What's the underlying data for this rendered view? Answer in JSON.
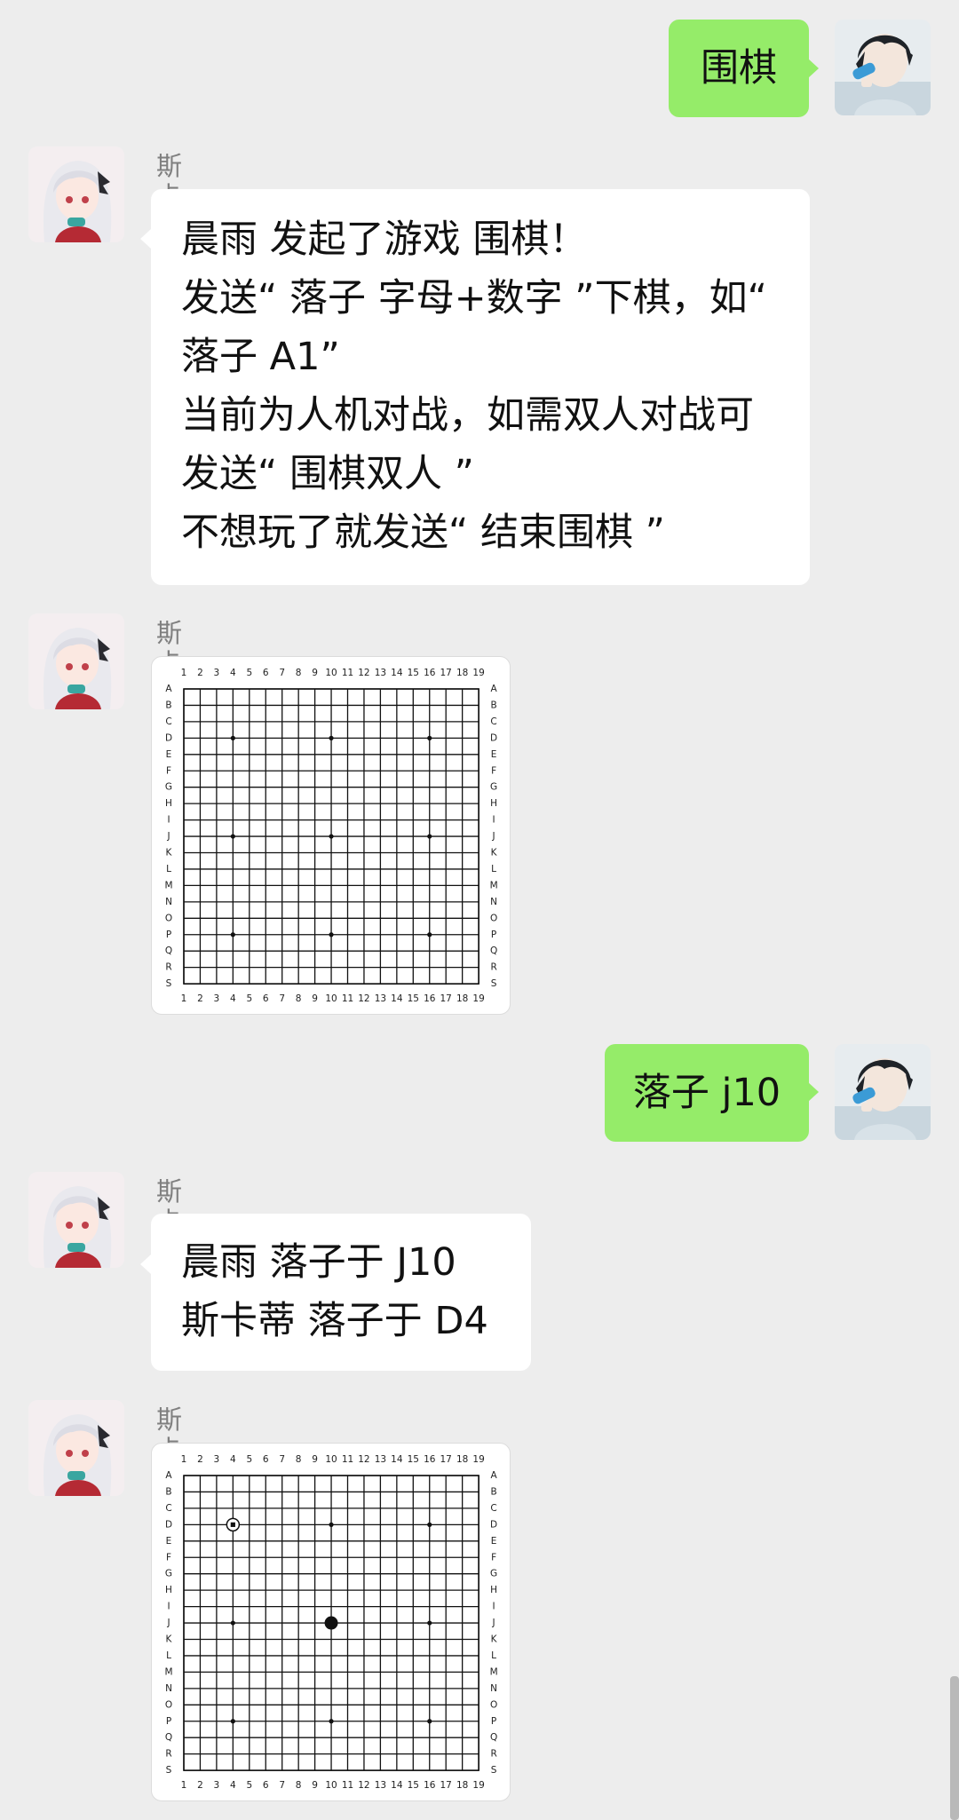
{
  "chat": {
    "sender_name": "斯卡蒂",
    "messages": [
      {
        "from": "me",
        "text": "围棋"
      },
      {
        "from": "bot",
        "lines": [
          "晨雨 发起了游戏 围棋！",
          "发送“ 落子 字母+数字 ”下棋，如“",
          "落子 A1”",
          "当前为人机对战，如需双人对战可",
          "发送“ 围棋双人 ”",
          "不想玩了就发送“ 结束围棋 ”"
        ]
      },
      {
        "from": "bot",
        "kind": "board",
        "board_index": 0
      },
      {
        "from": "me",
        "text": "落子 j10"
      },
      {
        "from": "bot",
        "lines": [
          "晨雨 落子于 J10",
          "斯卡蒂 落子于 D4"
        ]
      },
      {
        "from": "bot",
        "kind": "board",
        "board_index": 1
      }
    ]
  },
  "boards": [
    {
      "col_labels": [
        "1",
        "2",
        "3",
        "4",
        "5",
        "6",
        "7",
        "8",
        "9",
        "10",
        "11",
        "12",
        "13",
        "14",
        "15",
        "16",
        "17",
        "18",
        "19"
      ],
      "row_labels": [
        "A",
        "B",
        "C",
        "D",
        "E",
        "F",
        "G",
        "H",
        "I",
        "J",
        "K",
        "L",
        "M",
        "N",
        "O",
        "P",
        "Q",
        "R",
        "S"
      ],
      "star_points": [
        "D4",
        "D10",
        "D16",
        "J4",
        "J10",
        "J16",
        "P4",
        "P10",
        "P16"
      ],
      "stones": []
    },
    {
      "col_labels": [
        "1",
        "2",
        "3",
        "4",
        "5",
        "6",
        "7",
        "8",
        "9",
        "10",
        "11",
        "12",
        "13",
        "14",
        "15",
        "16",
        "17",
        "18",
        "19"
      ],
      "row_labels": [
        "A",
        "B",
        "C",
        "D",
        "E",
        "F",
        "G",
        "H",
        "I",
        "J",
        "K",
        "L",
        "M",
        "N",
        "O",
        "P",
        "Q",
        "R",
        "S"
      ],
      "star_points": [
        "D4",
        "D10",
        "D16",
        "J4",
        "J10",
        "J16",
        "P4",
        "P10",
        "P16"
      ],
      "stones": [
        {
          "point": "J10",
          "color": "black",
          "last_move": false
        },
        {
          "point": "D4",
          "color": "white",
          "last_move": true
        }
      ]
    }
  ],
  "colors": {
    "background": "#ededed",
    "my_bubble": "#95ec69",
    "bot_bubble": "#ffffff",
    "sender_name": "#7f7f7f"
  }
}
